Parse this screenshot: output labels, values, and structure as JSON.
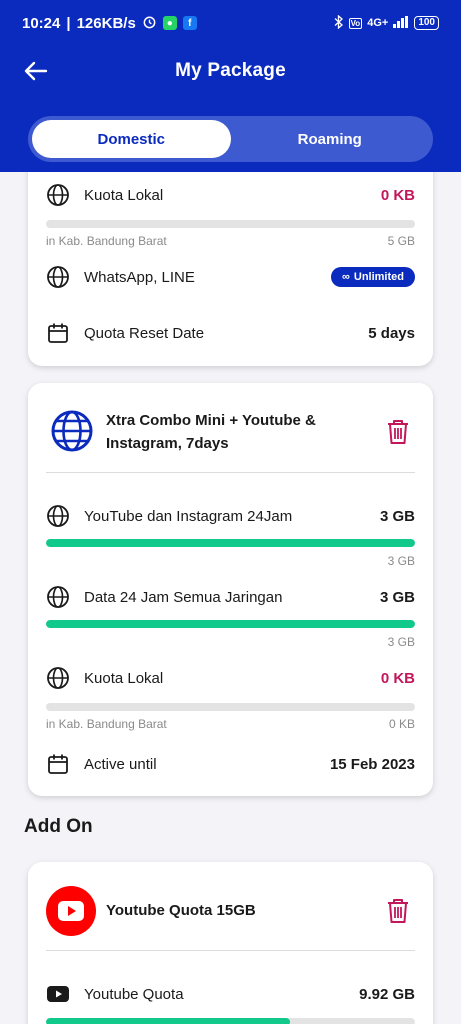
{
  "status_bar": {
    "time": "10:24",
    "speed": "126KB/s",
    "network": "4G+",
    "battery": "100"
  },
  "header": {
    "title": "My Package"
  },
  "tabs": [
    {
      "label": "Domestic",
      "active": true
    },
    {
      "label": "Roaming",
      "active": false
    }
  ],
  "card1": {
    "rows": [
      {
        "label": "Kuota Lokal",
        "value": "0 KB",
        "used_fraction": 0,
        "sub_left": "in Kab. Bandung Barat",
        "sub_right": "5 GB"
      },
      {
        "label": "WhatsApp, LINE",
        "badge": "Unlimited"
      },
      {
        "label": "Quota Reset Date",
        "value": "5 days"
      }
    ]
  },
  "card2": {
    "title_line1": "Xtra Combo Mini + Youtube &",
    "title_line2": "Instagram, 7days",
    "rows": [
      {
        "label": "YouTube dan Instagram 24Jam",
        "value": "3 GB",
        "fill_fraction": 1,
        "sub_right": "3 GB"
      },
      {
        "label": "Data 24 Jam Semua Jaringan",
        "value": "3 GB",
        "fill_fraction": 1,
        "sub_right": "3 GB"
      },
      {
        "label": "Kuota Lokal",
        "value": "0 KB",
        "fill_fraction": 0,
        "sub_left": "in Kab. Bandung Barat",
        "sub_right": "0 KB"
      },
      {
        "label": "Active until",
        "value": "15 Feb 2023"
      }
    ]
  },
  "addon": {
    "section_title": "Add On",
    "title": "Youtube Quota 15GB",
    "rows": [
      {
        "label": "Youtube Quota",
        "value": "9.92 GB",
        "fill_fraction": 0.66
      }
    ]
  },
  "colors": {
    "brand": "#0b2bbf",
    "green": "#12c98c",
    "red": "#c2185b"
  }
}
